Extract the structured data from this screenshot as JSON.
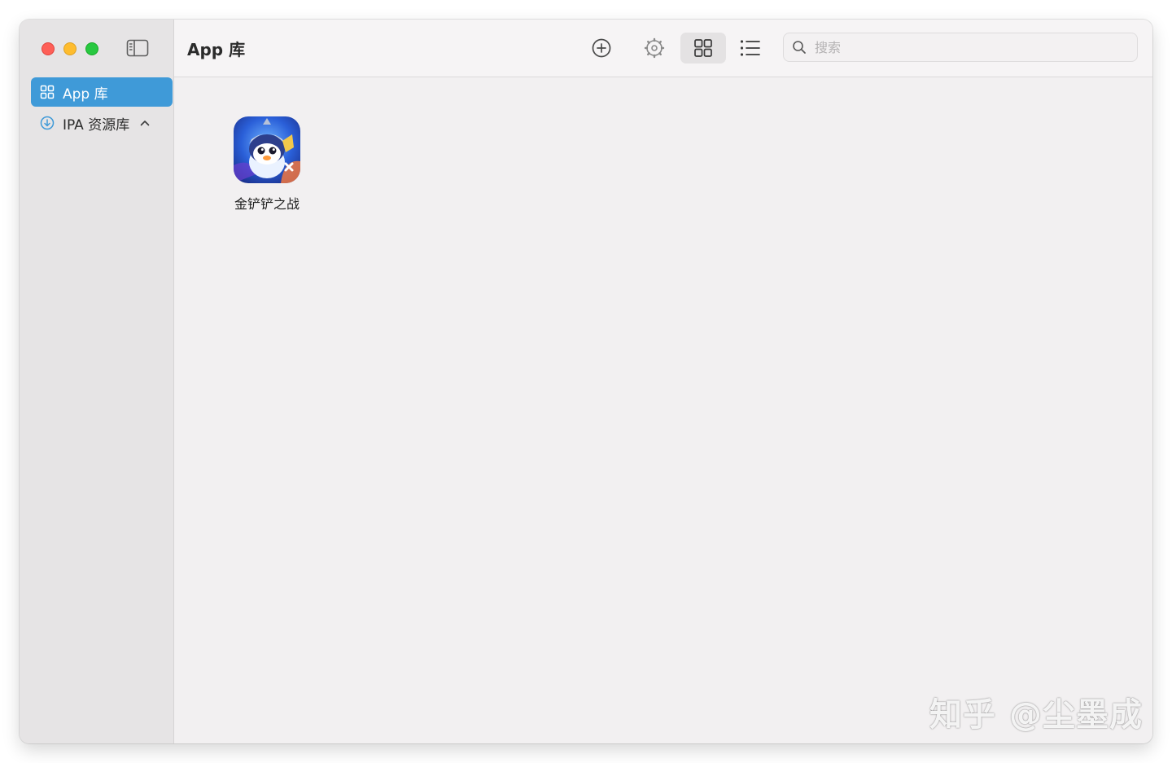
{
  "window": {
    "traffic_lights": {
      "close_color": "#fe5f57",
      "minimize_color": "#febc2e",
      "maximize_color": "#28c840"
    }
  },
  "sidebar": {
    "items": [
      {
        "label": "App 库",
        "icon": "grid-icon",
        "active": true
      },
      {
        "label": "IPA 资源库",
        "icon": "download-circle-icon",
        "active": false,
        "expand_icon": "chevron-up-icon"
      }
    ],
    "accent_color": "#3f9ad8"
  },
  "toolbar": {
    "title": "App 库",
    "buttons": [
      {
        "name": "add",
        "icon": "plus-circle-icon"
      },
      {
        "name": "settings",
        "icon": "gear-icon"
      },
      {
        "name": "grid-view",
        "icon": "grid-view-icon",
        "selected": true
      },
      {
        "name": "list-view",
        "icon": "list-view-icon"
      }
    ],
    "search": {
      "placeholder": "搜索",
      "value": ""
    }
  },
  "content": {
    "apps": [
      {
        "name": "金铲铲之战",
        "icon": "penguin-game-icon"
      }
    ]
  },
  "watermark": {
    "brand": "知乎",
    "handle": "@尘墨成"
  }
}
